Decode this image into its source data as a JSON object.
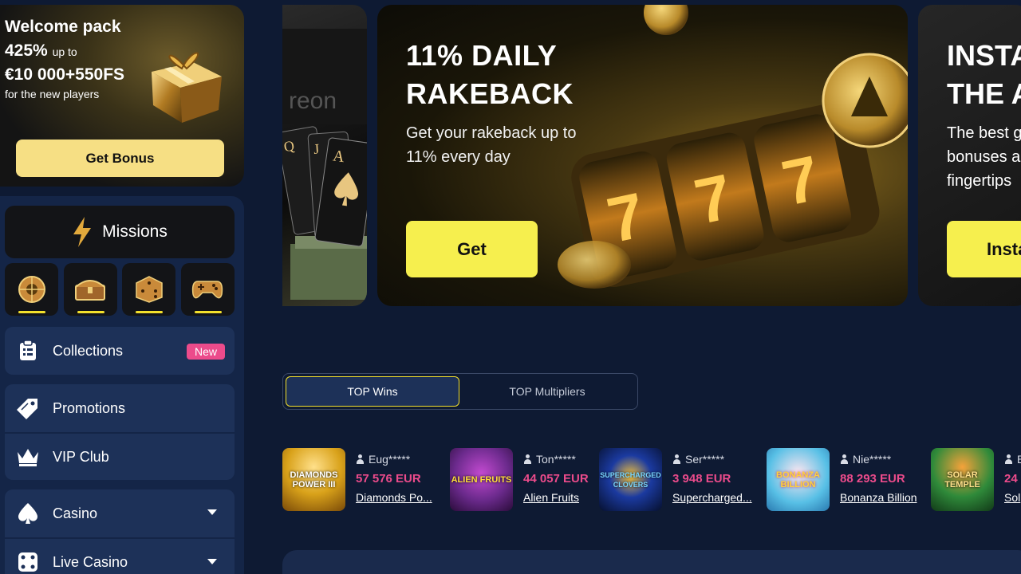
{
  "welcome": {
    "title": "Welcome pack",
    "percent": "425%",
    "up_to": "up to",
    "amount": "€10 000+550FS",
    "subtitle": "for the new players",
    "button": "Get Bonus"
  },
  "sidebar": {
    "missions_label": "Missions",
    "mission_tiles": [
      "roulette-icon",
      "chest-icon",
      "dice-icon",
      "gamepad-icon"
    ],
    "collections_label": "Collections",
    "collections_badge": "New",
    "promotions_label": "Promotions",
    "vip_label": "VIP Club",
    "casino_label": "Casino",
    "live_casino_label": "Live Casino"
  },
  "banners": {
    "main": {
      "title_line1": "11% DAILY",
      "title_line2": "RAKEBACK",
      "subtitle": "Get your rakeback up to 11% every day",
      "button": "Get"
    },
    "right": {
      "title_line1": "INSTA",
      "title_line2": "THE A",
      "sub_line1": "The best g",
      "sub_line2": "bonuses a",
      "sub_line3": "fingertips",
      "button": "Insta"
    }
  },
  "tabs": {
    "active": "TOP Wins",
    "inactive": "TOP Multipliers"
  },
  "wins": [
    {
      "user": "Eug*****",
      "amount": "57 576 EUR",
      "game": "Diamonds Po...",
      "thumb_text": "DIAMONDS POWER III",
      "thumb_color": "#d9a21a"
    },
    {
      "user": "Ton*****",
      "amount": "44 057 EUR",
      "game": "Alien Fruits",
      "thumb_text": "ALIEN FRUITS",
      "thumb_color": "#6b2a8c"
    },
    {
      "user": "Ser*****",
      "amount": "3 948 EUR",
      "game": "Supercharged...",
      "thumb_text": "SUPERCHARGED CLOVERS",
      "thumb_color": "#0c1e5a"
    },
    {
      "user": "Nie*****",
      "amount": "88 293 EUR",
      "game": "Bonanza Billion",
      "thumb_text": "BONANZA BILLION",
      "thumb_color": "#58c0e6"
    },
    {
      "user": "B",
      "amount": "24",
      "game": "Sol",
      "thumb_text": "SOLAR TEMPLE",
      "thumb_color": "#2f8a3a"
    }
  ]
}
